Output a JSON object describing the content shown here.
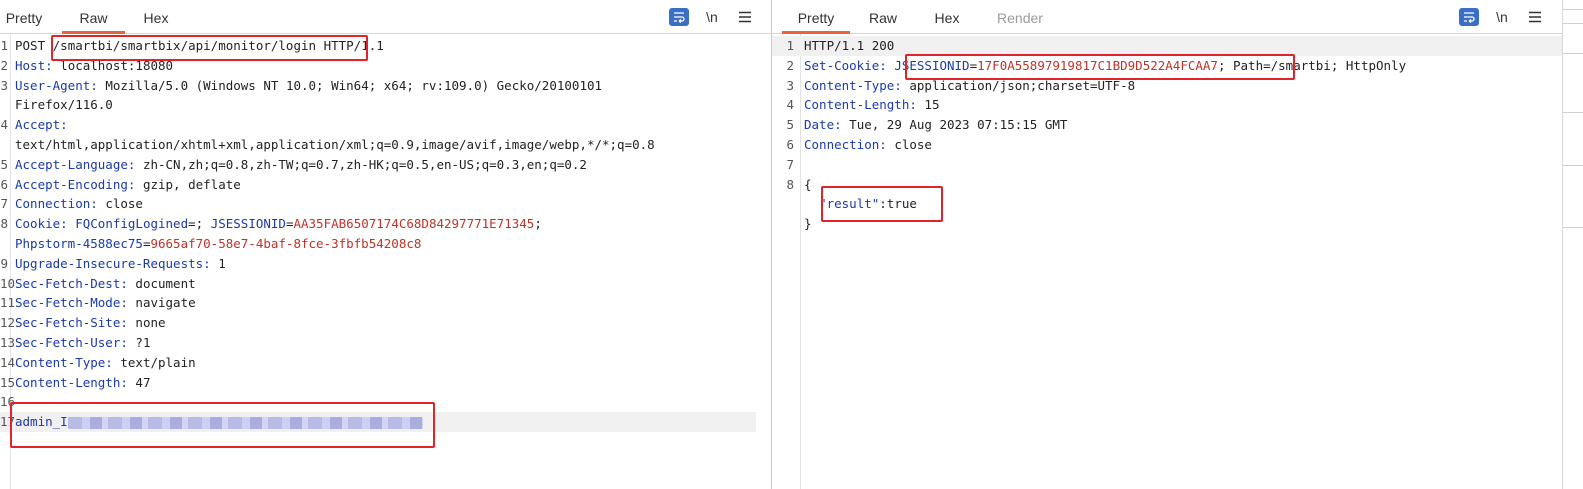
{
  "request": {
    "tabs": [
      {
        "label": "Pretty",
        "active": false
      },
      {
        "label": "Raw",
        "active": true
      },
      {
        "label": "Hex",
        "active": false
      }
    ],
    "toolbar": {
      "wrap_icon": "wrap-lines-icon",
      "newline_label": "\\n",
      "menu_icon": "hamburger-menu-icon"
    },
    "lines": [
      {
        "n": "1",
        "parts": [
          {
            "t": "POST ",
            "c": "v"
          },
          {
            "t": "/smartbi/smartbix/api/monitor/login",
            "c": "v"
          },
          {
            "t": " HTTP/1.1",
            "c": "v"
          }
        ]
      },
      {
        "n": "2",
        "parts": [
          {
            "t": "Host:",
            "c": "k"
          },
          {
            "t": " localhost:18080",
            "c": "v"
          }
        ]
      },
      {
        "n": "3",
        "parts": [
          {
            "t": "User-Agent:",
            "c": "k"
          },
          {
            "t": " Mozilla/5.0 (Windows NT 10.0; Win64; x64; rv:109.0) Gecko/20100101",
            "c": "v"
          }
        ]
      },
      {
        "n": "",
        "parts": [
          {
            "t": "Firefox/116.0",
            "c": "v"
          }
        ]
      },
      {
        "n": "4",
        "parts": [
          {
            "t": "Accept:",
            "c": "k"
          }
        ]
      },
      {
        "n": "",
        "parts": [
          {
            "t": "text/html,application/xhtml+xml,application/xml;q=0.9,image/avif,image/webp,*/*;q=0.8",
            "c": "v"
          }
        ]
      },
      {
        "n": "5",
        "parts": [
          {
            "t": "Accept-Language:",
            "c": "k"
          },
          {
            "t": " zh-CN,zh;q=0.8,zh-TW;q=0.7,zh-HK;q=0.5,en-US;q=0.3,en;q=0.2",
            "c": "v"
          }
        ]
      },
      {
        "n": "6",
        "parts": [
          {
            "t": "Accept-Encoding:",
            "c": "k"
          },
          {
            "t": " gzip, deflate",
            "c": "v"
          }
        ]
      },
      {
        "n": "7",
        "parts": [
          {
            "t": "Connection:",
            "c": "k"
          },
          {
            "t": " close",
            "c": "v"
          }
        ]
      },
      {
        "n": "8",
        "parts": [
          {
            "t": "Cookie:",
            "c": "k"
          },
          {
            "t": " ",
            "c": "v"
          },
          {
            "t": "FQConfigLogined",
            "c": "k"
          },
          {
            "t": "=; ",
            "c": "v"
          },
          {
            "t": "JSESSIONID",
            "c": "k"
          },
          {
            "t": "=",
            "c": "v"
          },
          {
            "t": "AA35FAB6507174C68D84297771E71345",
            "c": "r"
          },
          {
            "t": ";",
            "c": "v"
          }
        ]
      },
      {
        "n": "",
        "parts": [
          {
            "t": "Phpstorm-4588ec75",
            "c": "k"
          },
          {
            "t": "=",
            "c": "v"
          },
          {
            "t": "9665af70-58e7-4baf-8fce-3fbfb54208c8",
            "c": "r"
          }
        ]
      },
      {
        "n": "9",
        "parts": [
          {
            "t": "Upgrade-Insecure-Requests:",
            "c": "k"
          },
          {
            "t": " 1",
            "c": "v"
          }
        ]
      },
      {
        "n": "10",
        "parts": [
          {
            "t": "Sec-Fetch-Dest:",
            "c": "k"
          },
          {
            "t": " document",
            "c": "v"
          }
        ]
      },
      {
        "n": "11",
        "parts": [
          {
            "t": "Sec-Fetch-Mode:",
            "c": "k"
          },
          {
            "t": " navigate",
            "c": "v"
          }
        ]
      },
      {
        "n": "12",
        "parts": [
          {
            "t": "Sec-Fetch-Site:",
            "c": "k"
          },
          {
            "t": " none",
            "c": "v"
          }
        ]
      },
      {
        "n": "13",
        "parts": [
          {
            "t": "Sec-Fetch-User:",
            "c": "k"
          },
          {
            "t": " ?1",
            "c": "v"
          }
        ]
      },
      {
        "n": "14",
        "parts": [
          {
            "t": "Content-Type:",
            "c": "k"
          },
          {
            "t": " text/plain",
            "c": "v"
          }
        ]
      },
      {
        "n": "15",
        "parts": [
          {
            "t": "Content-Length:",
            "c": "k"
          },
          {
            "t": " 47",
            "c": "v"
          }
        ]
      },
      {
        "n": "16",
        "parts": []
      },
      {
        "n": "17",
        "parts": [
          {
            "t": "admin_I",
            "c": "k"
          }
        ],
        "blurred": true,
        "highlight": true
      }
    ]
  },
  "response": {
    "tabs": [
      {
        "label": "Pretty",
        "active": true
      },
      {
        "label": "Raw",
        "active": false
      },
      {
        "label": "Hex",
        "active": false
      },
      {
        "label": "Render",
        "active": false,
        "dim": true
      }
    ],
    "toolbar": {
      "wrap_icon": "wrap-lines-icon",
      "newline_label": "\\n",
      "menu_icon": "hamburger-menu-icon"
    },
    "lines": [
      {
        "n": "1",
        "parts": [
          {
            "t": "HTTP/1.1 200",
            "c": "v"
          }
        ],
        "highlight": true
      },
      {
        "n": "2",
        "parts": [
          {
            "t": "Set-Cookie:",
            "c": "k"
          },
          {
            "t": " ",
            "c": "v"
          },
          {
            "t": "JSESSIONID",
            "c": "k"
          },
          {
            "t": "=",
            "c": "v"
          },
          {
            "t": "17F0A55897919817C1BD9D522A4FCAA7",
            "c": "r"
          },
          {
            "t": "; Path=/smartbi; HttpOnly",
            "c": "v"
          }
        ]
      },
      {
        "n": "3",
        "parts": [
          {
            "t": "Content-Type:",
            "c": "k"
          },
          {
            "t": " application/json;charset=UTF-8",
            "c": "v"
          }
        ]
      },
      {
        "n": "4",
        "parts": [
          {
            "t": "Content-Length:",
            "c": "k"
          },
          {
            "t": " 15",
            "c": "v"
          }
        ]
      },
      {
        "n": "5",
        "parts": [
          {
            "t": "Date:",
            "c": "k"
          },
          {
            "t": " Tue, 29 Aug 2023 07:15:15 GMT",
            "c": "v"
          }
        ]
      },
      {
        "n": "6",
        "parts": [
          {
            "t": "Connection:",
            "c": "k"
          },
          {
            "t": " close",
            "c": "v"
          }
        ]
      },
      {
        "n": "7",
        "parts": []
      },
      {
        "n": "8",
        "parts": [
          {
            "t": "{",
            "c": "v"
          }
        ]
      },
      {
        "n": "",
        "parts": [
          {
            "t": "  ",
            "c": "v"
          },
          {
            "t": "\"result\"",
            "c": "k"
          },
          {
            "t": ":true",
            "c": "v"
          }
        ]
      },
      {
        "n": "",
        "parts": [
          {
            "t": "}",
            "c": "v"
          }
        ]
      }
    ]
  }
}
